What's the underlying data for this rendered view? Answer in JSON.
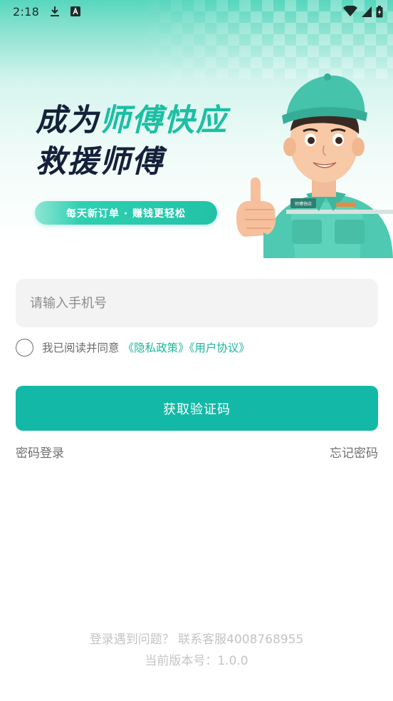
{
  "status_bar": {
    "time": "2:18",
    "left_icons": [
      "download-icon",
      "app-notification-icon"
    ],
    "right_icons": [
      "wifi-icon",
      "cellular-signal-icon",
      "battery-icon"
    ]
  },
  "banner": {
    "headline_line1_prefix": "成为",
    "headline_line1_accent": "师傅快应",
    "headline_line2": "救援师傅",
    "slogan": "每天新订单 · 赚钱更轻松",
    "badge_text": "师傅快应",
    "accent_color": "#1cbfa3",
    "headline_color": "#15213a"
  },
  "form": {
    "phone_placeholder": "请输入手机号",
    "phone_value": "",
    "agree_checked": false,
    "agree_text": "我已阅读并同意",
    "privacy_link": "《隐私政策》",
    "user_agreement_link": "《用户协议》",
    "submit_label": "获取验证码",
    "password_login": "密码登录",
    "forgot_password": "忘记密码"
  },
  "footer": {
    "help_text": "登录遇到问题？ 联系客服4008768955",
    "version_text": "当前版本号：1.0.0"
  },
  "colors": {
    "primary": "#13b9a6",
    "link": "#1cb69c",
    "input_bg": "#f3f3f3"
  }
}
